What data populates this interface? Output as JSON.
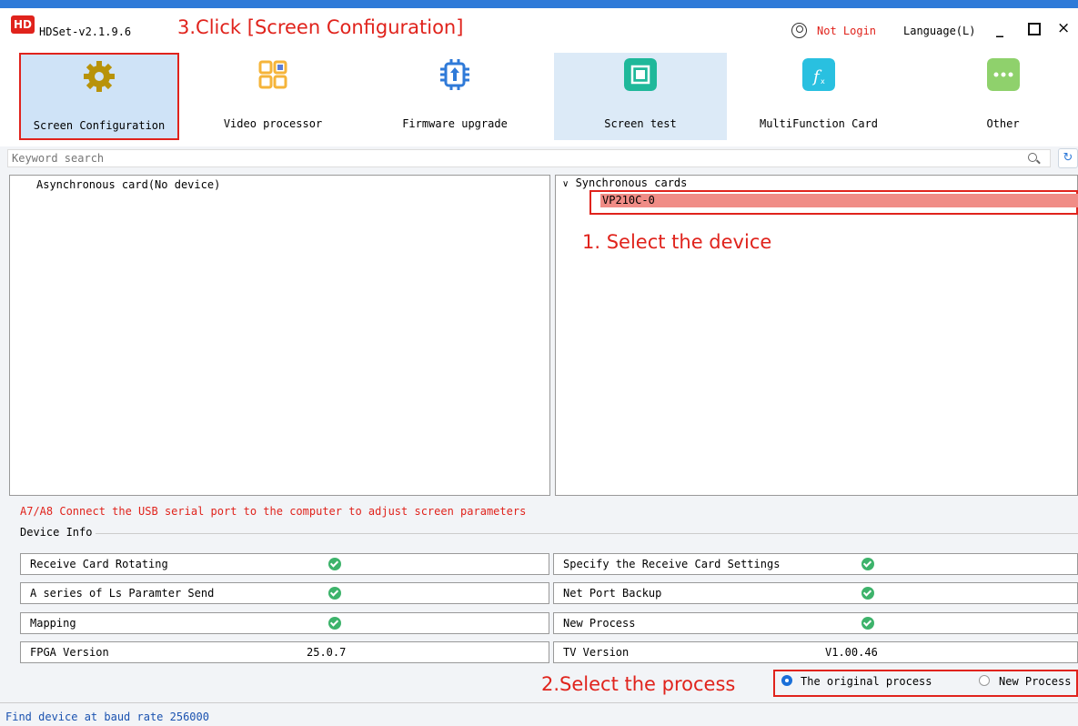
{
  "window": {
    "logo": "HD",
    "title": "HDSet-v2.1.9.6",
    "login": "Not Login",
    "language": "Language(L)",
    "minimize": "_",
    "close": "×"
  },
  "annotations": {
    "step1": "1. Select the device",
    "step2": "2.Select the process",
    "step3": "3.Click [Screen Configuration]"
  },
  "toolbar": [
    {
      "label": "Screen Configuration",
      "icon": "gear-icon",
      "color": "#b8930a"
    },
    {
      "label": "Video processor",
      "icon": "grid-icon",
      "color": "#f5b43a"
    },
    {
      "label": "Firmware upgrade",
      "icon": "chip-upgrade-icon",
      "color": "#2f7ad8"
    },
    {
      "label": "Screen test",
      "icon": "screen-test-icon",
      "color": "#1fb89a"
    },
    {
      "label": "MultiFunction Card",
      "icon": "function-icon",
      "color": "#29c0e0"
    },
    {
      "label": "Other",
      "icon": "more-icon",
      "color": "#8fd16c"
    }
  ],
  "search": {
    "placeholder": "Keyword search"
  },
  "async_panel": {
    "label": "Asynchronous card(No device)"
  },
  "sync_panel": {
    "header": "Synchronous cards",
    "device": "VP210C-0"
  },
  "hint": "A7/A8 Connect the USB serial port to the computer to adjust screen parameters",
  "device_info": {
    "title": "Device Info",
    "left": [
      {
        "label": "Receive Card Rotating",
        "value": "",
        "check": true
      },
      {
        "label": "A series of Ls Paramter Send",
        "value": "",
        "check": true
      },
      {
        "label": "Mapping",
        "value": "",
        "check": true
      },
      {
        "label": "FPGA Version",
        "value": "25.0.7",
        "check": false
      }
    ],
    "right": [
      {
        "label": "Specify the Receive Card Settings",
        "value": "",
        "check": true
      },
      {
        "label": "Net Port Backup",
        "value": "",
        "check": true
      },
      {
        "label": "New Process",
        "value": "",
        "check": true
      },
      {
        "label": "TV Version",
        "value": "V1.00.46",
        "check": false
      }
    ]
  },
  "process": {
    "original": "The original process",
    "new": "New Process",
    "selected": "original"
  },
  "status": "Find device at baud rate 256000"
}
